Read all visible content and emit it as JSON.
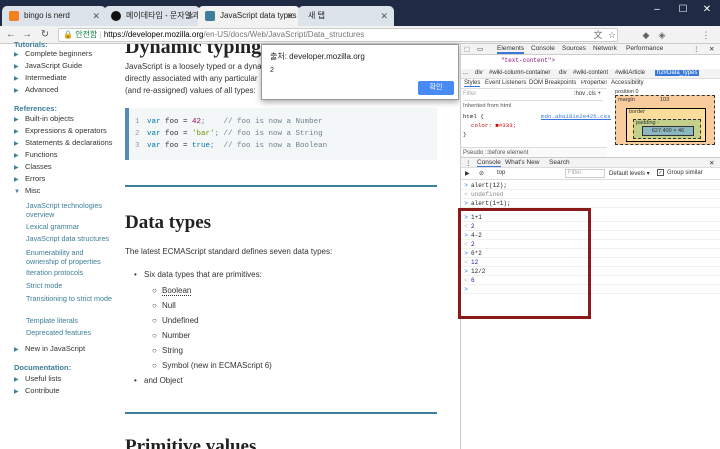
{
  "browser": {
    "tabs": [
      {
        "label": "bingo is nerd",
        "icon_color": "#f48120"
      },
      {
        "label": "메이데타입 - 문자열과",
        "icon_color": "#111111"
      },
      {
        "label": "JavaScript data types and",
        "icon_color": "#3d7e9a"
      },
      {
        "label": "새 탭",
        "icon_color": ""
      }
    ],
    "address": {
      "secure_label": "안전함",
      "url_host": "https://developer.mozilla.org",
      "url_path": "/en-US/docs/Web/JavaScript/Data_structures"
    }
  },
  "sidebar": {
    "tutorials_heading": "Tutorials:",
    "tutorials": [
      "Complete beginners",
      "JavaScript Guide",
      "Intermediate",
      "Advanced"
    ],
    "references_heading": "References:",
    "references": [
      "Built-in objects",
      "Expressions & operators",
      "Statements & declarations",
      "Functions",
      "Classes",
      "Errors",
      "Misc"
    ],
    "misc_items": [
      "JavaScript technologies overview",
      "Lexical grammar",
      "JavaScript data structures",
      "Enumerability and ownership of properties",
      "Iteration protocols",
      "Strict mode",
      "Transitioning to strict mode",
      "Template literals",
      "Deprecated features"
    ],
    "new_in_js": "New in JavaScript",
    "documentation_heading": "Documentation:",
    "documentation": [
      "Useful lists",
      "Contribute"
    ]
  },
  "main": {
    "heading_dynamic": "Dynamic typing",
    "para1_line1": "JavaScript is a loosely typed or a dynamic",
    "para1_line2": "directly associated with any particular",
    "para1_line3": "(and re-assigned) values of all types:",
    "code": [
      {
        "n": "1",
        "kw": "var",
        "name": " foo = ",
        "val": "42",
        "cmt": ";    // foo is now a Number"
      },
      {
        "n": "2",
        "kw": "var",
        "name": " foo = ",
        "val": "'bar'",
        "cmt": "; // foo is now a String"
      },
      {
        "n": "3",
        "kw": "var",
        "name": " foo = ",
        "val": "true",
        "cmt": ";  // foo is now a Boolean"
      }
    ],
    "heading_data_types": "Data types",
    "para2": "The latest ECMAScript standard defines seven data types:",
    "primitives_intro": "Six data types that are primitives:",
    "primitives": [
      "Boolean",
      "Null",
      "Undefined",
      "Number",
      "String",
      "Symbol (new in ECMAScript 6)"
    ],
    "and_object": "and Object",
    "heading_primitive": "Primitive values"
  },
  "alert": {
    "title": "출처: developer.mozilla.org",
    "message": "2",
    "ok_label": "확인"
  },
  "devtools": {
    "tabs": [
      "Elements",
      "Console",
      "Sources",
      "Network",
      "Performance"
    ],
    "html_line": "\"text-content\">",
    "breadcrumbs": [
      "...",
      "div",
      "#wiki-column-container",
      "div",
      "#wiki-content",
      "#wikiArticle",
      "h2#Data_types"
    ],
    "subtabs": [
      "Styles",
      "Event Listeners",
      "DOM Breakpoints",
      "Properties",
      "Accessibility"
    ],
    "filter_placeholder": "Filter",
    "filter_opts": ":hov  .cls  +",
    "inherited_from": "Inherited from html",
    "html_rule": "html {",
    "html_rule_src": "mdn.aba181e2e425.css:4",
    "html_prop": "color: ■#333;",
    "pseudo_label": "Pseudo ::before element",
    "boxmodel": {
      "position": "position 0",
      "margin": "margin",
      "margin_val": "103",
      "border": "border",
      "padding": "padding -",
      "content": "627.400 × 46"
    },
    "console_tabs": [
      "Console",
      "What's New",
      "Search"
    ],
    "console_context": "top",
    "console_filter": "Filter",
    "console_levels": "Default levels ▾",
    "group_similar": "Group similar",
    "console_lines": [
      {
        "type": "in",
        "text": "alert(12);"
      },
      {
        "type": "out",
        "text": "undefined"
      },
      {
        "type": "in",
        "text": "alert(1+1);"
      },
      {
        "type": "in",
        "text": "1+1"
      },
      {
        "type": "out",
        "text": "2"
      },
      {
        "type": "in",
        "text": "4-2"
      },
      {
        "type": "out",
        "text": "2"
      },
      {
        "type": "in",
        "text": "6*2"
      },
      {
        "type": "out",
        "text": "12"
      },
      {
        "type": "in",
        "text": "12/2"
      },
      {
        "type": "out",
        "text": "6"
      },
      {
        "type": "in",
        "text": ""
      }
    ]
  },
  "colors": {
    "accent": "#3d7e9a",
    "highlight_box": "#8b1a1a",
    "devtools_blue": "#3879d9"
  }
}
